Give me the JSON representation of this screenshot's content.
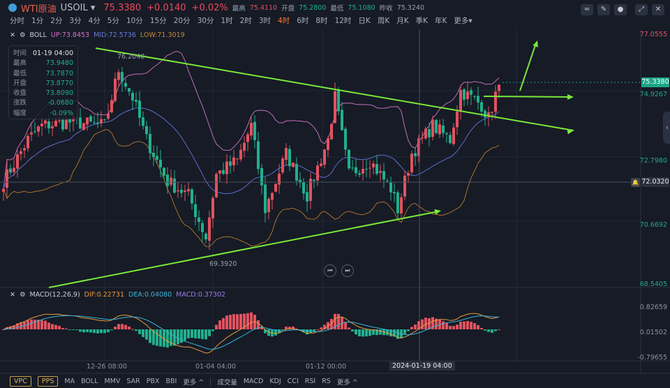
{
  "header": {
    "name": "WTI原油",
    "code": "USOIL",
    "price": "75.3380",
    "change": "+0.0140",
    "change_pct": "+0.02%",
    "high_label": "最高",
    "high": "75.4110",
    "open_label": "开盘",
    "open": "75.2800",
    "low_label": "最低",
    "low": "75.1080",
    "prev_label": "昨收",
    "prev": "75.3240"
  },
  "periods": [
    "分时",
    "1分",
    "2分",
    "3分",
    "4分",
    "5分",
    "10分",
    "15分",
    "20分",
    "30分",
    "1时",
    "2时",
    "3时",
    "4时",
    "6时",
    "8时",
    "12时",
    "日K",
    "周K",
    "月K",
    "季K",
    "年K",
    "更多▾"
  ],
  "active_period": "4时",
  "boll": {
    "name": "BOLL",
    "up": "UP:73.8453",
    "mid": "MID:72.5736",
    "low": "LOW:71.3019"
  },
  "info": {
    "rows": [
      [
        "时间",
        "01-19 04:00"
      ],
      [
        "最高",
        "73.9480"
      ],
      [
        "最低",
        "73.7870"
      ],
      [
        "开盘",
        "73.8770"
      ],
      [
        "收盘",
        "73.8090"
      ],
      [
        "涨跌",
        "-0.0680"
      ],
      [
        "幅度",
        "-0.09%"
      ]
    ]
  },
  "price_axis": [
    "77.0555",
    "74.9267",
    "72.7980",
    "70.6692",
    "68.5405"
  ],
  "current_price_tag": "75.3380",
  "crosshair_price": "72.0320",
  "annotations": {
    "high": "76.2040",
    "low": "69.3920"
  },
  "macd": {
    "name": "MACD(12,26,9)",
    "dif": "DIF:0.22731",
    "dea": "DEA:0.04080",
    "macd": "MACD:0.37302",
    "axis": [
      "0.82659",
      "0.01502",
      "-0.79655"
    ]
  },
  "time_axis": [
    "12-26 08:00",
    "01-04 04:00",
    "01-12 00:00"
  ],
  "crosshair_time": "2024-01-19 04:00",
  "bottom": {
    "left": [
      "VPC",
      "PPS"
    ],
    "main": [
      "MA",
      "BOLL",
      "MMV",
      "SAR",
      "PBX",
      "BBI",
      "更多 ^"
    ],
    "sub": [
      "成交量",
      "MACD",
      "KDJ",
      "CCI",
      "RSI",
      "RS",
      "更多 ^"
    ]
  },
  "colors": {
    "up": "#e2525f",
    "down": "#21b08c",
    "trend": "#7be83a"
  },
  "chart_data": {
    "type": "candlestick",
    "ylim": [
      68.5405,
      77.0555
    ],
    "price_path": [
      [
        0,
        72.05
      ],
      [
        7,
        73.47
      ],
      [
        11,
        73.95
      ],
      [
        19,
        74.07
      ],
      [
        29,
        73.95
      ],
      [
        33,
        75.85
      ],
      [
        37,
        74.9
      ],
      [
        41,
        73.47
      ],
      [
        47,
        72.05
      ],
      [
        53,
        71.58
      ],
      [
        58,
        70.15
      ],
      [
        61,
        72.29
      ],
      [
        67,
        72.76
      ],
      [
        71,
        73.95
      ],
      [
        75,
        71.1
      ],
      [
        81,
        73.0
      ],
      [
        87,
        71.58
      ],
      [
        93,
        73.47
      ],
      [
        95,
        74.9
      ],
      [
        99,
        72.29
      ],
      [
        105,
        72.76
      ],
      [
        111,
        71.81
      ],
      [
        113,
        71.1
      ],
      [
        117,
        73.0
      ],
      [
        123,
        73.95
      ],
      [
        128,
        73.47
      ],
      [
        131,
        75.13
      ],
      [
        137,
        74.66
      ],
      [
        139,
        74.19
      ],
      [
        142,
        75.42
      ]
    ]
  }
}
